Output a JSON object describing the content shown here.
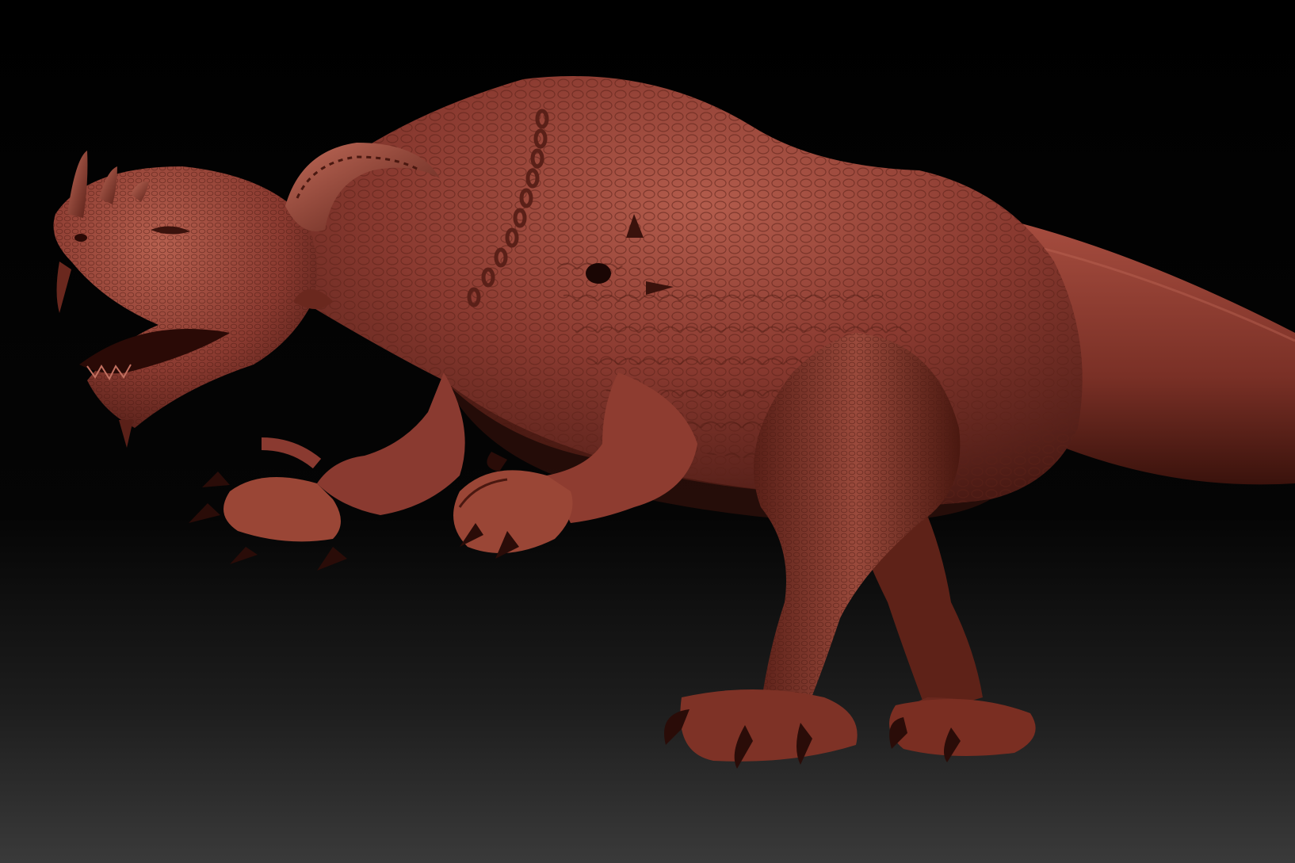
{
  "scene": {
    "subject": "creature-sculpt",
    "colors": {
      "background_top": "#000000",
      "background_bottom": "#3a3a3a",
      "clay_base": "#8a3a30",
      "clay_light": "#b2584a",
      "clay_dark": "#4a1a14",
      "clay_shadow": "#2a0c08"
    }
  }
}
